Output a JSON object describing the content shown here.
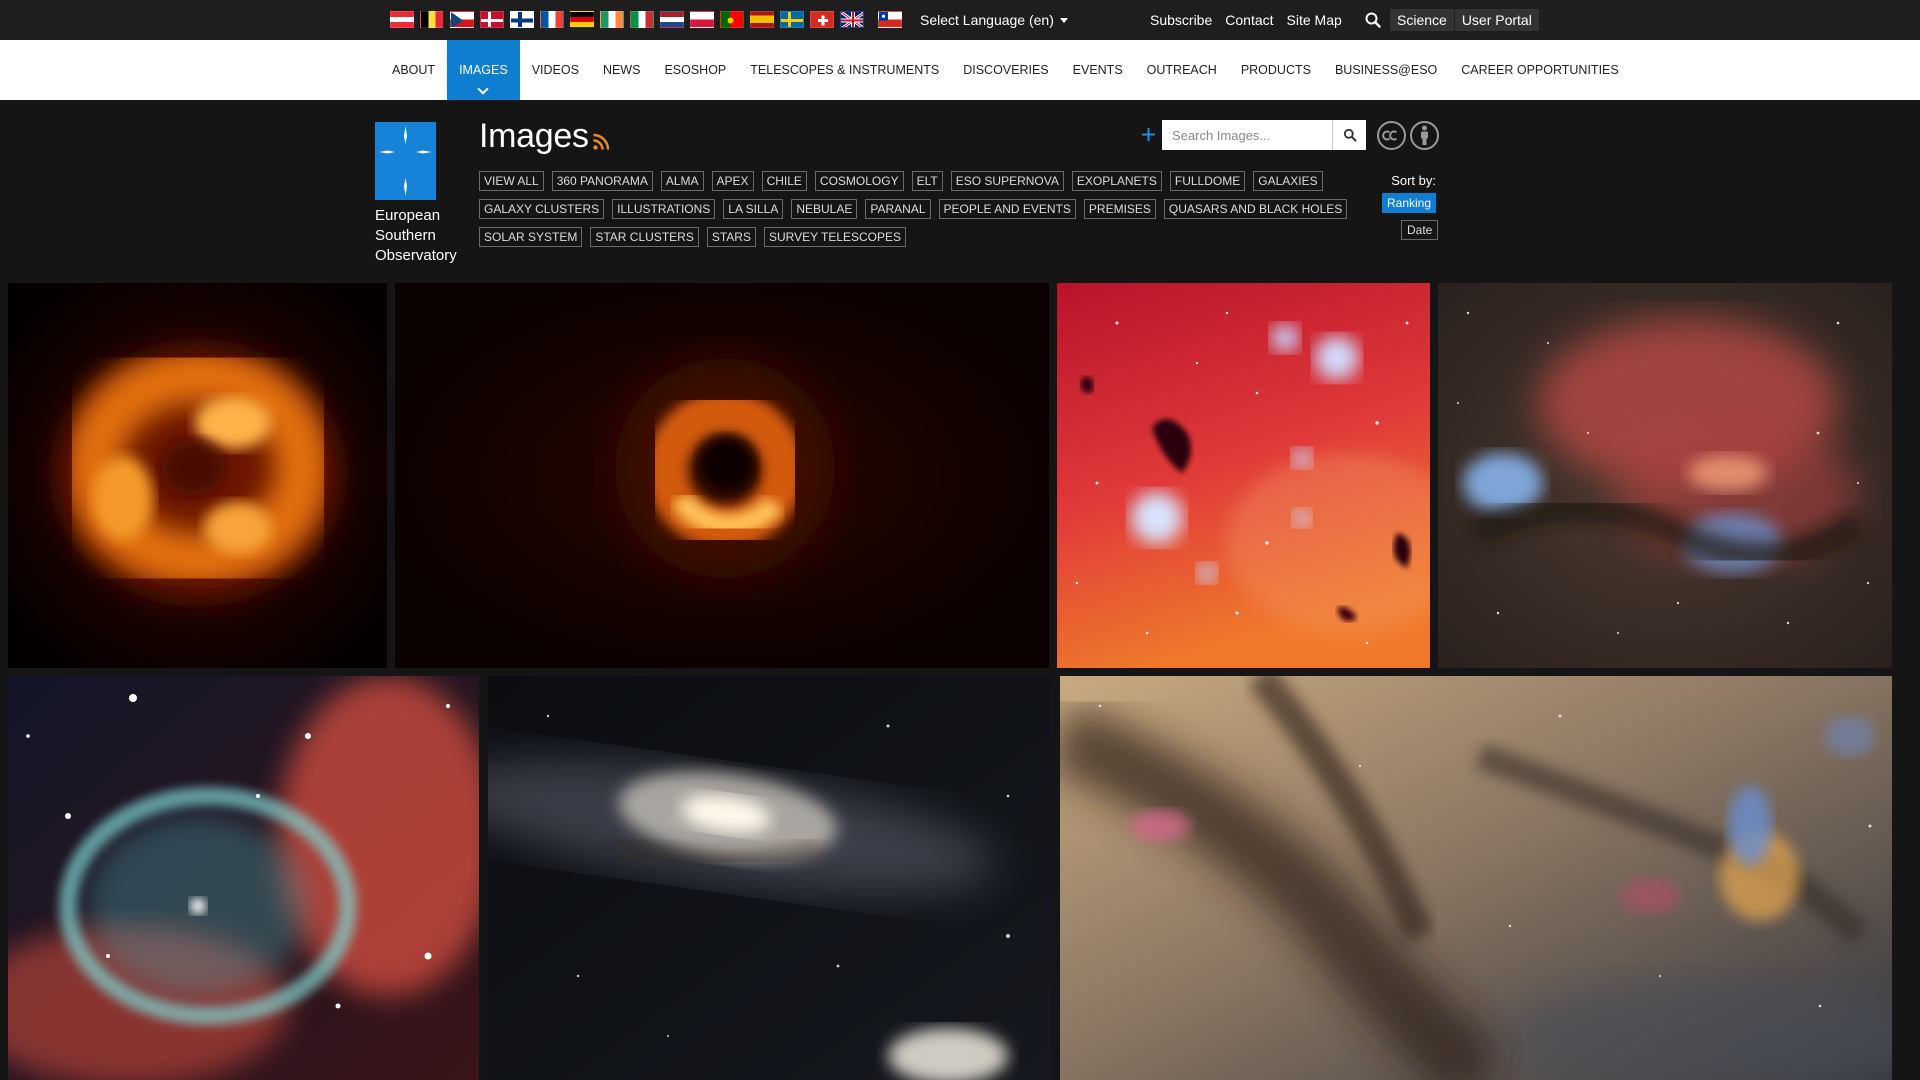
{
  "top_bar": {
    "flags": [
      {
        "name": "austria-flag"
      },
      {
        "name": "belgium-flag"
      },
      {
        "name": "czech-flag"
      },
      {
        "name": "denmark-flag"
      },
      {
        "name": "finland-flag"
      },
      {
        "name": "france-flag"
      },
      {
        "name": "germany-flag"
      },
      {
        "name": "ireland-flag"
      },
      {
        "name": "italy-flag"
      },
      {
        "name": "netherlands-flag"
      },
      {
        "name": "poland-flag"
      },
      {
        "name": "portugal-flag"
      },
      {
        "name": "spain-flag"
      },
      {
        "name": "sweden-flag"
      },
      {
        "name": "switzerland-flag"
      },
      {
        "name": "uk-flag"
      },
      {
        "name": "chile-flag"
      }
    ],
    "language_label": "Select Language (en)",
    "links": [
      "Subscribe",
      "Contact",
      "Site Map"
    ],
    "portal_buttons": [
      "Science",
      "User Portal"
    ]
  },
  "nav": {
    "items": [
      "ABOUT",
      "IMAGES",
      "VIDEOS",
      "NEWS",
      "ESOSHOP",
      "TELESCOPES & INSTRUMENTS",
      "DISCOVERIES",
      "EVENTS",
      "OUTREACH",
      "PRODUCTS",
      "BUSINESS@ESO",
      "CAREER OPPORTUNITIES"
    ],
    "active": "IMAGES"
  },
  "org": {
    "logo_text": "ESO",
    "name_lines": [
      "European",
      "Southern",
      "Observatory"
    ]
  },
  "page": {
    "title": "Images"
  },
  "tags": {
    "rows": [
      [
        "VIEW ALL",
        "360 PANORAMA",
        "ALMA",
        "APEX",
        "CHILE",
        "COSMOLOGY",
        "ELT",
        "ESO SUPERNOVA",
        "EXOPLANETS",
        "FULLDOME",
        "GALAXIES"
      ],
      [
        "GALAXY CLUSTERS",
        "ILLUSTRATIONS",
        "LA SILLA",
        "NEBULAE",
        "PARANAL",
        "PEOPLE AND EVENTS",
        "PREMISES",
        "QUASARS AND BLACK HOLES"
      ],
      [
        "SOLAR SYSTEM",
        "STAR CLUSTERS",
        "STARS",
        "SURVEY TELESCOPES"
      ]
    ]
  },
  "search": {
    "placeholder": "Search Images..."
  },
  "sort": {
    "label": "Sort by:",
    "options": [
      "Ranking",
      "Date"
    ],
    "selected": "Ranking"
  },
  "gallery": {
    "images": [
      {
        "name": "black-hole-sgr-a-image"
      },
      {
        "name": "black-hole-m87-image"
      },
      {
        "name": "red-nebula-blue-stars-image"
      },
      {
        "name": "colorful-nebula-starfield-image"
      },
      {
        "name": "thors-helmet-nebula-image"
      },
      {
        "name": "galaxies-pair-image"
      },
      {
        "name": "milky-way-dust-clouds-image"
      }
    ],
    "colors": {
      "accent": "#0f7dd0",
      "orange_glow": "#ff9a1e"
    }
  }
}
